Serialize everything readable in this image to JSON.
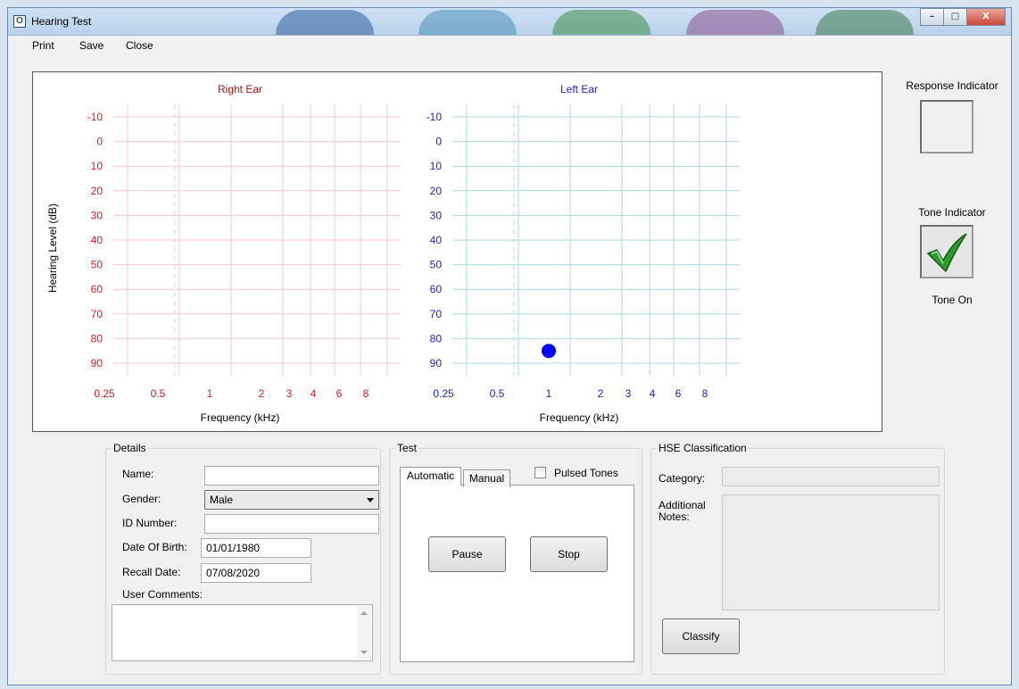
{
  "window": {
    "title": "Hearing Test",
    "min_glyph": "–",
    "max_glyph": "□",
    "close_glyph": "X"
  },
  "menu": {
    "print": "Print",
    "save": "Save",
    "close": "Close"
  },
  "colors": {
    "right_ear": "#e8171b",
    "right_title": "#a31515",
    "right_grid": "#f5c9d2",
    "left_ear": "#1d1dd6",
    "left_grid": "#a9dbe2",
    "point": "#0000ff"
  },
  "chart_data": [
    {
      "type": "scatter",
      "title": "Right Ear",
      "xlabel": "Frequency (kHz)",
      "ylabel": "Hearing Level (dB)",
      "x_ticks": [
        "0.25",
        "0.5",
        "1",
        "2",
        "3",
        "4",
        "6",
        "8"
      ],
      "y_ticks": [
        "-10",
        "0",
        "10",
        "20",
        "30",
        "40",
        "50",
        "60",
        "70",
        "80",
        "90"
      ],
      "ylim": [
        -10,
        90
      ],
      "y_inverted": true,
      "grid": true,
      "points": []
    },
    {
      "type": "scatter",
      "title": "Left Ear",
      "xlabel": "Frequency (kHz)",
      "x_ticks": [
        "0.25",
        "0.5",
        "1",
        "2",
        "3",
        "4",
        "6",
        "8"
      ],
      "y_ticks": [
        "-10",
        "0",
        "10",
        "20",
        "30",
        "40",
        "50",
        "60",
        "70",
        "80",
        "90"
      ],
      "ylim": [
        -10,
        90
      ],
      "y_inverted": true,
      "grid": true,
      "points": [
        {
          "x": 1,
          "y": 85
        }
      ]
    }
  ],
  "indicators": {
    "response_label": "Response Indicator",
    "tone_label": "Tone Indicator",
    "tone_status": "Tone On",
    "tone_icon": "checkmark-icon"
  },
  "details": {
    "legend": "Details",
    "name_label": "Name:",
    "name_value": "",
    "gender_label": "Gender:",
    "gender_value": "Male",
    "id_label": "ID Number:",
    "id_value": "",
    "dob_label": "Date Of Birth:",
    "dob_value": "01/01/1980",
    "recall_label": "Recall Date:",
    "recall_value": "07/08/2020",
    "comments_label": "User Comments:"
  },
  "test": {
    "legend": "Test",
    "tab_automatic": "Automatic",
    "tab_manual": "Manual",
    "pulsed_label": "Pulsed Tones",
    "pulsed_checked": false,
    "pause_label": "Pause",
    "stop_label": "Stop"
  },
  "hse": {
    "legend": "HSE Classification",
    "category_label": "Category:",
    "notes_label_1": "Additional",
    "notes_label_2": "Notes:",
    "classify_label": "Classify"
  }
}
